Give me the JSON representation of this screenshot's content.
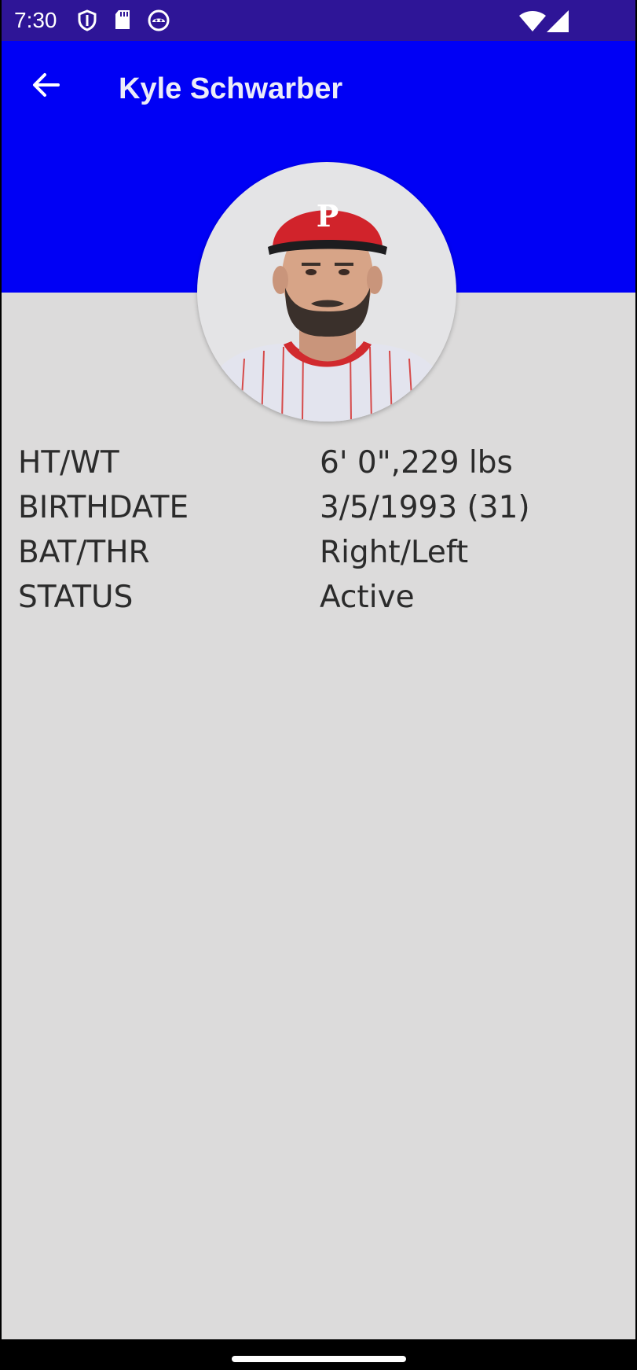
{
  "status_bar": {
    "time": "7:30",
    "icons": [
      "shield-icon",
      "sd-card-icon",
      "android-debug-icon",
      "wifi-icon",
      "cell-signal-icon"
    ]
  },
  "app_bar": {
    "title": "Kyle Schwarber",
    "back_icon": "arrow-back-icon",
    "color": "#0000f5"
  },
  "player": {
    "avatar_description": "player-headshot",
    "stats": [
      {
        "label": "HT/WT",
        "value": "6' 0\",229 lbs"
      },
      {
        "label": "BIRTHDATE",
        "value": "3/5/1993 (31)"
      },
      {
        "label": "BAT/THR",
        "value": "Right/Left"
      },
      {
        "label": "STATUS",
        "value": "Active"
      }
    ]
  },
  "colors": {
    "status_bar": "#2e1597",
    "background": "#dcdbdb"
  }
}
